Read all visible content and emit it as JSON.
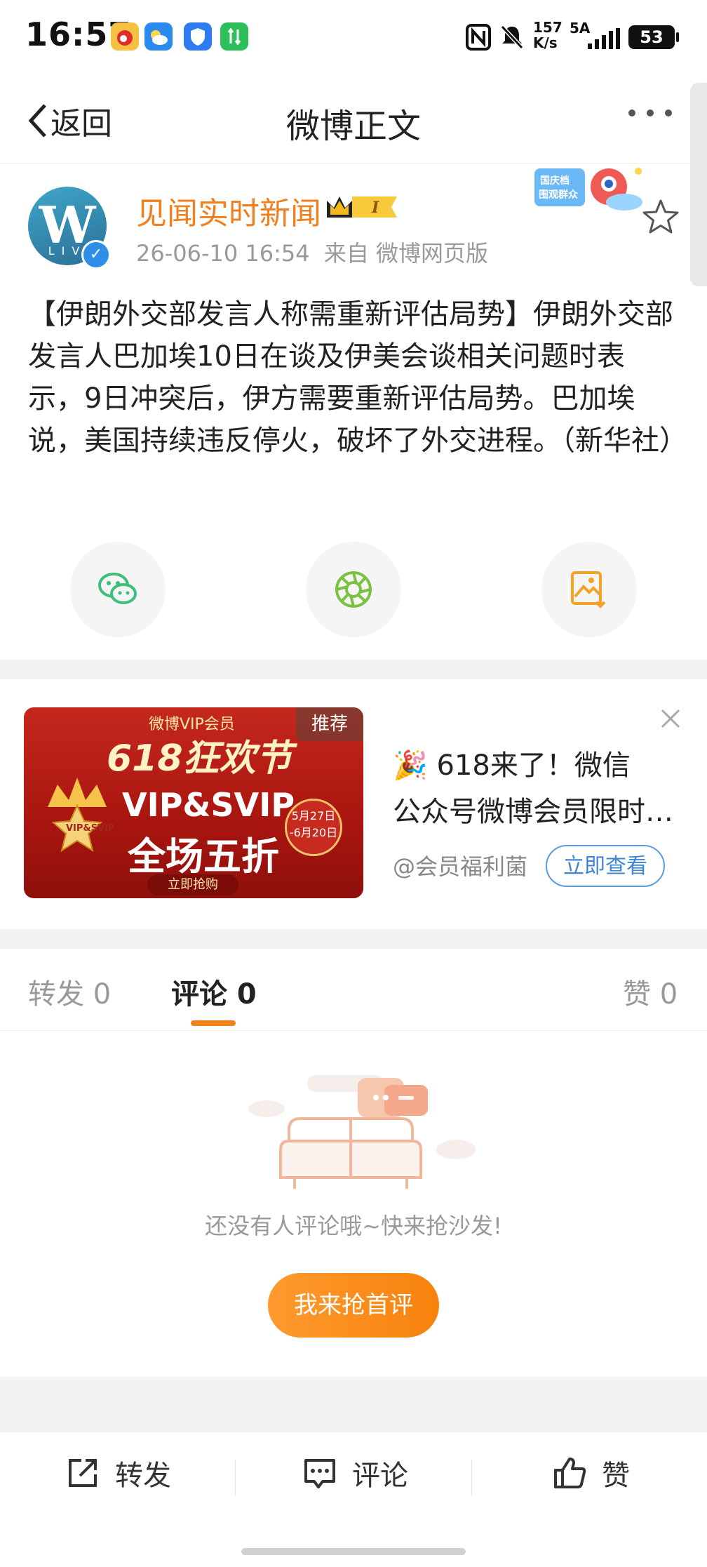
{
  "status_bar": {
    "time": "16:57",
    "net_speed_top": "157",
    "net_speed_unit": "K/s",
    "network": "5A",
    "battery": "53"
  },
  "nav": {
    "back_label": "返回",
    "title": "微博正文"
  },
  "post": {
    "author": "见闻实时新闻",
    "vip_level": "I",
    "avatar_letter": "W",
    "avatar_sub": "LIV",
    "timestamp": "26-06-10 16:54",
    "source": "来自 微博网页版",
    "sticker_text": "国庆档 围观群众",
    "content": "【伊朗外交部发言人称需重新评估局势】伊朗外交部发言人巴加埃10日在谈及伊美会谈相关问题时表示，9日冲突后，伊方需要重新评估局势。巴加埃说，美国持续违反停火，破坏了外交进程。（新华社）"
  },
  "ad": {
    "image": {
      "top_label": "微博VIP会员",
      "headline": "618狂欢节",
      "vip_line": "VIP&SVIP",
      "discount": "全场五折",
      "buy_label": "立即抢购",
      "date_line1": "5月27日",
      "date_line2": "-6月20日",
      "crown_label": "VIP&SVIP",
      "recommend": "推荐"
    },
    "title_line1": "🎉 618来了！微信",
    "title_line2": "公众号微博会员限时五折",
    "source": "@会员福利菌",
    "cta": "立即查看"
  },
  "tabs": {
    "repost": "转发 0",
    "comment": "评论 0",
    "like": "赞 0"
  },
  "empty": {
    "text": "还没有人评论哦~快来抢沙发!",
    "button": "我来抢首评"
  },
  "bottom_bar": {
    "repost": "转发",
    "comment": "评论",
    "like": "赞"
  },
  "colors": {
    "accent": "#f07f1e",
    "link": "#3d86d6",
    "wechat": "#3fbd7a",
    "moments": "#7cc242",
    "save": "#f2a227"
  }
}
